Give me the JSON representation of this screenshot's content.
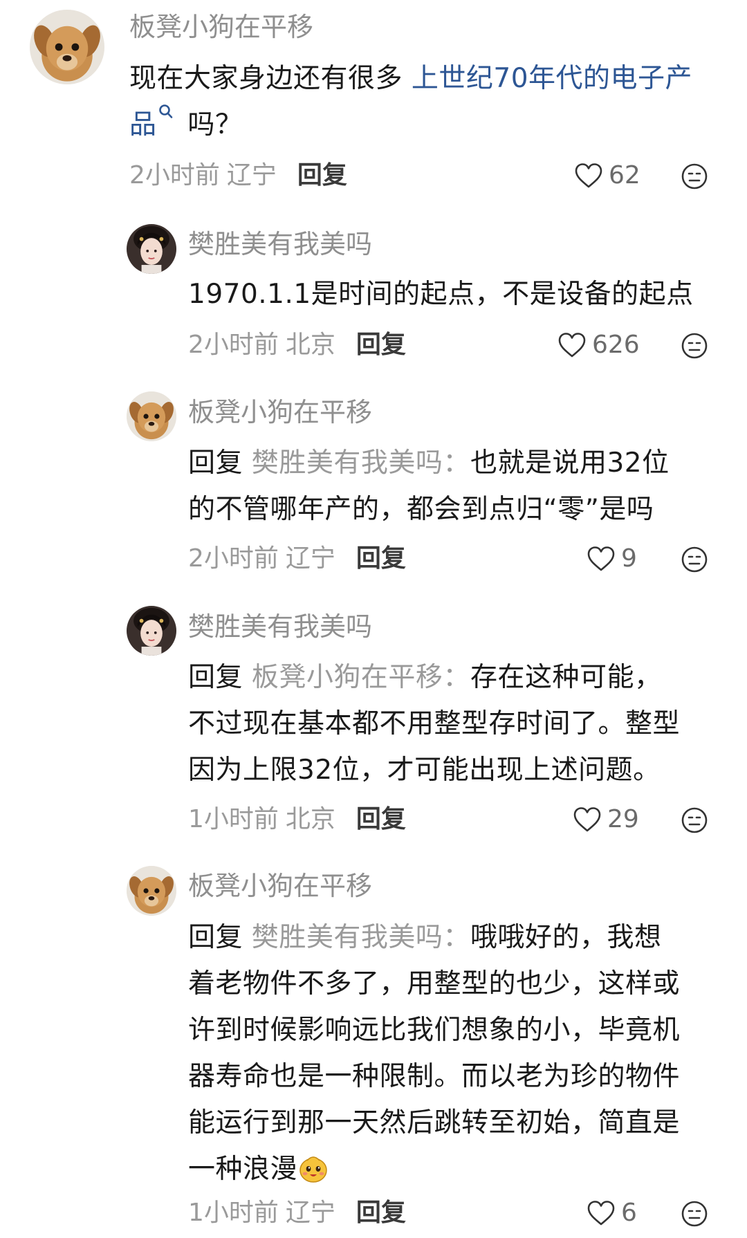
{
  "comments": [
    {
      "username": "板凳小狗在平移",
      "text_before": "现在大家身边还有很多 ",
      "link_text": "上世纪70年代的电子产",
      "link_text_2": "品",
      "text_after": " 吗？",
      "time": "2小时前",
      "location": "辽宁",
      "reply_label": "回复",
      "likes": "62"
    },
    {
      "username": "樊胜美有我美吗",
      "text": "1970.1.1是时间的起点，不是设备的起点",
      "time": "2小时前",
      "location": "北京",
      "reply_label": "回复",
      "likes": "626"
    },
    {
      "username": "板凳小狗在平移",
      "reply_word": "回复",
      "reply_target": "樊胜美有我美吗：",
      "text_line1": "也就是说用32位",
      "text_rest": "的不管哪年产的，都会到点归“零”是吗",
      "time": "2小时前",
      "location": "辽宁",
      "reply_label": "回复",
      "likes": "9"
    },
    {
      "username": "樊胜美有我美吗",
      "reply_word": "回复",
      "reply_target": "板凳小狗在平移：",
      "text_line1": "存在这种可能，",
      "text_line2": "不过现在基本都不用整型存时间了。整型",
      "text_line3": "因为上限32位，才可能出现上述问题。",
      "time": "1小时前",
      "location": "北京",
      "reply_label": "回复",
      "likes": "29"
    },
    {
      "username": "板凳小狗在平移",
      "reply_word": "回复",
      "reply_target": "樊胜美有我美吗：",
      "text_line1": "哦哦好的，我想",
      "text_line2": "着老物件不多了，用整型的也少，这样或",
      "text_line3": "许到时候影响远比我们想象的小，毕竟机",
      "text_line4": "器寿命也是一种限制。而以老为珍的物件",
      "text_line5": "能运行到那一天然后跳转至初始，简直是",
      "text_line6": "一种浪漫",
      "time": "1小时前",
      "location": "辽宁",
      "reply_label": "回复",
      "likes": "6"
    }
  ],
  "icons": {
    "like": "heart-outline-icon",
    "dislike": "neutral-face-icon",
    "search": "search-icon",
    "emoji": "cute-face-emoji"
  },
  "colors": {
    "username": "#8f8f8f",
    "link": "#2d5694",
    "meta": "#9a9a9a"
  }
}
